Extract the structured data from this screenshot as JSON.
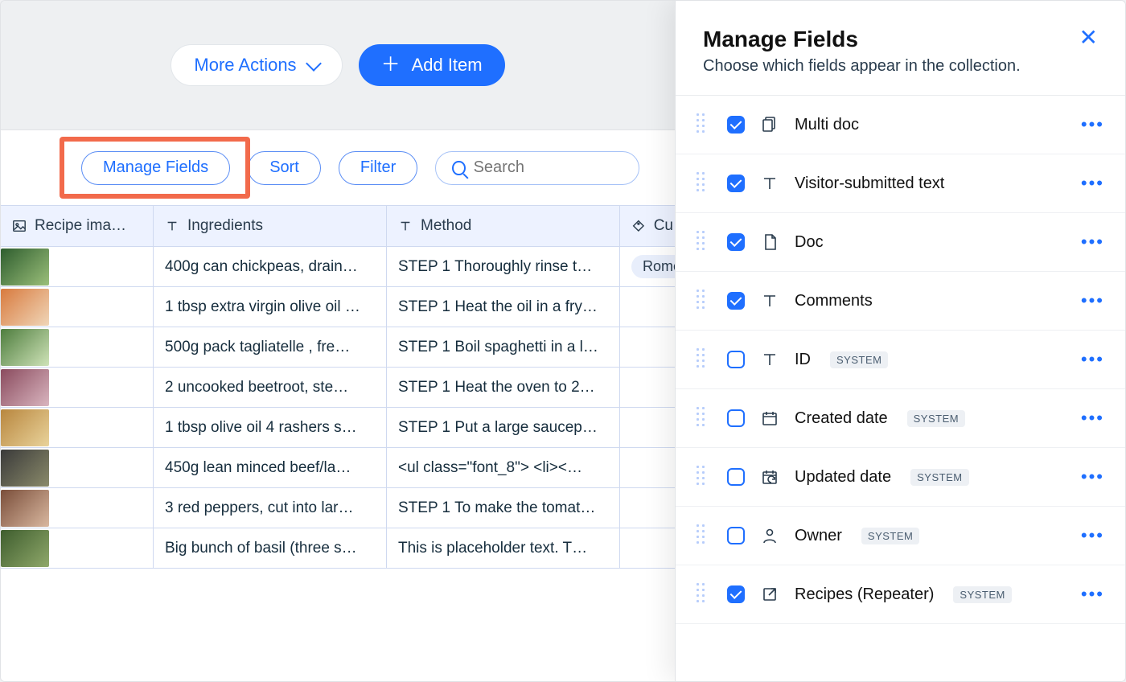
{
  "topbar": {
    "more_actions": "More Actions",
    "add_item": "Add Item"
  },
  "filters": {
    "manage_fields": "Manage Fields",
    "sort": "Sort",
    "filter": "Filter",
    "search_placeholder": "Search"
  },
  "columns": {
    "recipe_image": "Recipe ima…",
    "ingredients": "Ingredients",
    "method": "Method",
    "cuisine": "Cu…"
  },
  "rows": [
    {
      "ingredients": "400g can chickpeas, drain…",
      "method": "STEP 1 Thoroughly rinse t…",
      "cuisine": "Rome…"
    },
    {
      "ingredients": "1 tbsp extra virgin olive oil …",
      "method": "STEP 1 Heat the oil in a fry…",
      "cuisine": ""
    },
    {
      "ingredients": "500g pack tagliatelle , fre…",
      "method": "STEP 1 Boil spaghetti in a l…",
      "cuisine": ""
    },
    {
      "ingredients": "2 uncooked beetroot, ste…",
      "method": "STEP 1 Heat the oven to 2…",
      "cuisine": ""
    },
    {
      "ingredients": "1 tbsp olive oil 4 rashers s…",
      "method": "STEP 1 Put a large saucep…",
      "cuisine": ""
    },
    {
      "ingredients": "450g lean minced beef/la…",
      "method": "<ul class=\"font_8\"> <li><…",
      "cuisine": ""
    },
    {
      "ingredients": "3 red peppers, cut into lar…",
      "method": "STEP 1 To make the tomat…",
      "cuisine": ""
    },
    {
      "ingredients": "Big bunch of basil (three s…",
      "method": "This is placeholder text. T…",
      "cuisine": ""
    }
  ],
  "panel": {
    "title": "Manage Fields",
    "subtitle": "Choose which fields appear in the collection.",
    "system_badge": "SYSTEM",
    "fields": [
      {
        "label": "Multi doc",
        "checked": true,
        "icon": "multidoc",
        "system": false
      },
      {
        "label": "Visitor-submitted text",
        "checked": true,
        "icon": "text",
        "system": false
      },
      {
        "label": "Doc",
        "checked": true,
        "icon": "doc",
        "system": false
      },
      {
        "label": "Comments",
        "checked": true,
        "icon": "text",
        "system": false
      },
      {
        "label": "ID",
        "checked": false,
        "icon": "text",
        "system": true
      },
      {
        "label": "Created date",
        "checked": false,
        "icon": "calendar",
        "system": true
      },
      {
        "label": "Updated date",
        "checked": false,
        "icon": "calendar-refresh",
        "system": true
      },
      {
        "label": "Owner",
        "checked": false,
        "icon": "person",
        "system": true
      },
      {
        "label": "Recipes (Repeater)",
        "checked": true,
        "icon": "link-out",
        "system": true
      }
    ]
  }
}
